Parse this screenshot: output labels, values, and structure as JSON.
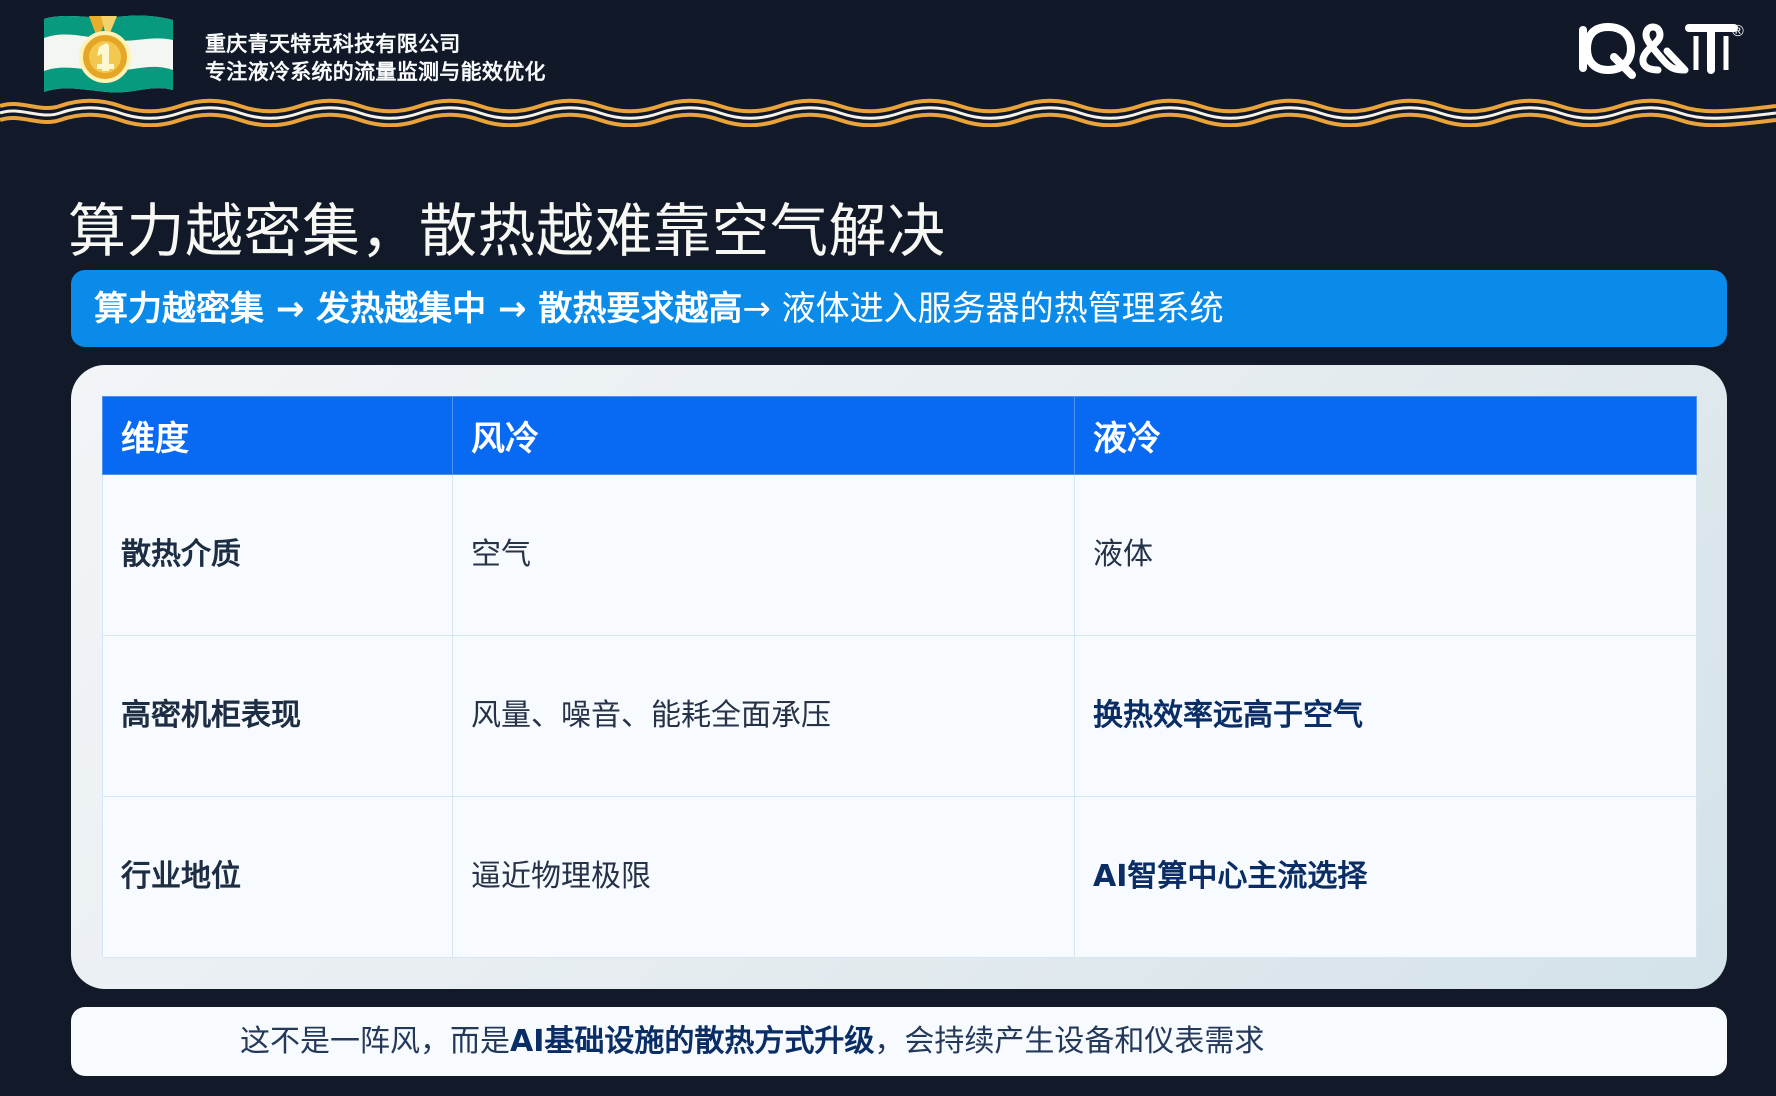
{
  "colors": {
    "background": "#121a2a",
    "header_wave_gold": "#e9a33a",
    "banner_blue": "#0a8be9",
    "table_header_blue": "#0869f2",
    "table_background": "#f7fbff",
    "emphasis_navy": "#0a2d66"
  },
  "header": {
    "company_name": "重庆青天特克科技有限公司",
    "company_tagline": "专注液冷系统的流量监测与能效优化",
    "left_logo_icon": "medal-flag-logo-icon",
    "brand_logo_text": "Q&T",
    "registered_mark": "®"
  },
  "main": {
    "title": "算力越密集，散热越难靠空气解决",
    "banner": {
      "strong_prefix": "算力越密集 → 发热越集中 → 散热要求越高",
      "regular_suffix": "→ 液体进入服务器的热管理系统"
    },
    "table": {
      "headers": [
        "维度",
        "风冷",
        "液冷"
      ],
      "rows": [
        {
          "dimension": "散热介质",
          "air": "空气",
          "liquid": "液体"
        },
        {
          "dimension": "高密机柜表现",
          "air": "风量、噪音、能耗全面承压",
          "liquid": "换热效率远高于空气"
        },
        {
          "dimension": "行业地位",
          "air": "逼近物理极限",
          "liquid": "AI智算中心主流选择"
        }
      ]
    },
    "bottom_note": {
      "prefix": "这不是一阵风，而是 ",
      "emphasis": "AI基础设施的散热方式升级",
      "suffix": "，会持续产生设备和仪表需求"
    }
  }
}
